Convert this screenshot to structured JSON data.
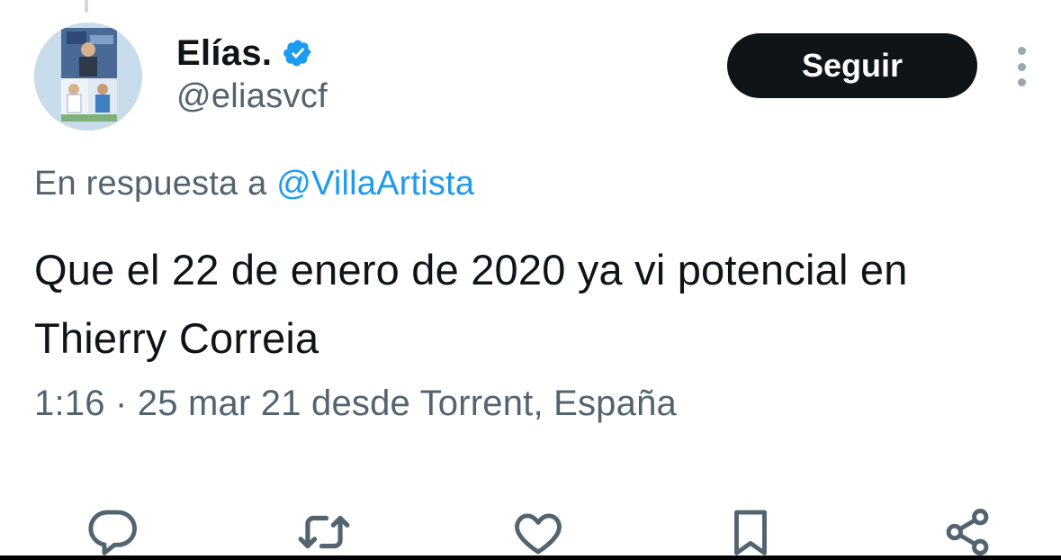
{
  "tweet": {
    "author": {
      "display_name": "Elías.",
      "handle": "@eliasvcf",
      "verified_icon": "verified-badge-icon",
      "avatar_icon": "avatar"
    },
    "follow_label": "Seguir",
    "reply_prefix": "En respuesta a",
    "reply_to": "@VillaArtista",
    "text": "Que el 22 de enero de 2020 ya vi potencial en Thierry Correia",
    "timestamp": "1:16 · 25 mar 21 desde Torrent, España"
  },
  "actions": [
    {
      "name": "reply-icon"
    },
    {
      "name": "retweet-icon"
    },
    {
      "name": "like-icon"
    },
    {
      "name": "bookmark-icon"
    },
    {
      "name": "share-icon"
    }
  ],
  "colors": {
    "text_primary": "#0f1419",
    "text_secondary": "#536471",
    "link": "#1d9bf0",
    "verified": "#1d9bf0",
    "follow_bg": "#0f1419",
    "follow_text": "#ffffff",
    "icon": "#536471"
  }
}
